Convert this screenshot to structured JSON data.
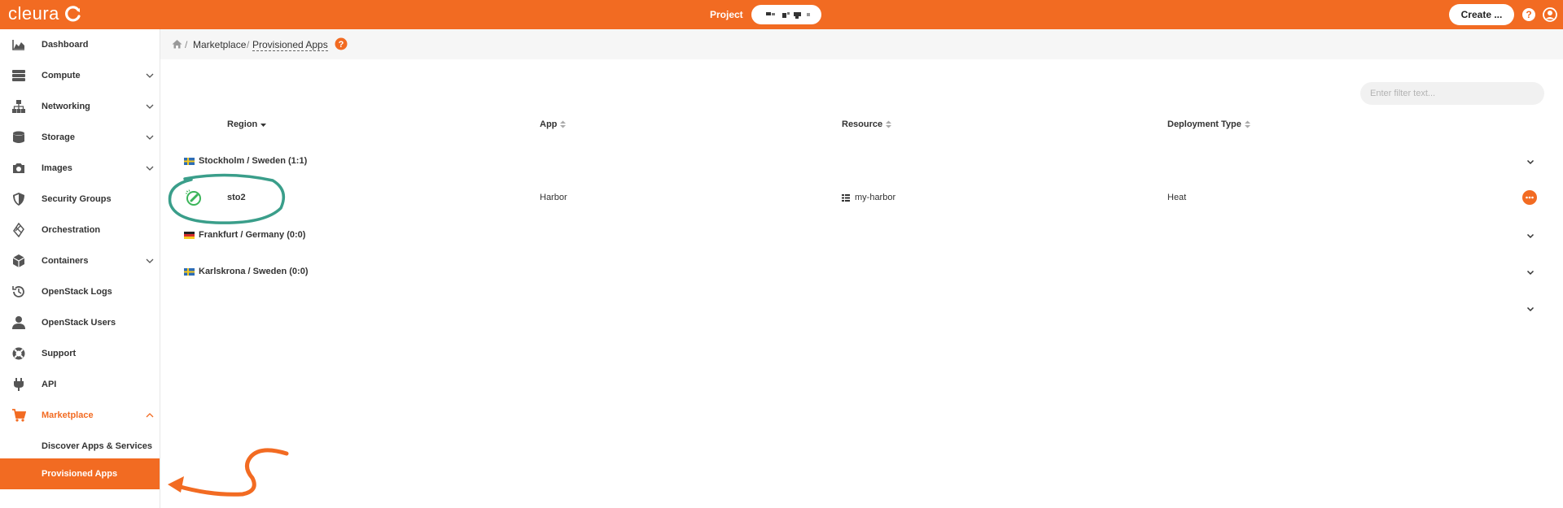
{
  "header": {
    "logo_text": "cleura",
    "project_label": "Project",
    "create_label": "Create ...",
    "brand_color": "#f26b22"
  },
  "sidebar": {
    "items": [
      {
        "label": "Dashboard",
        "icon": "chart-area-icon"
      },
      {
        "label": "Compute",
        "icon": "server-icon",
        "expandable": true
      },
      {
        "label": "Networking",
        "icon": "network-icon",
        "expandable": true
      },
      {
        "label": "Storage",
        "icon": "database-icon",
        "expandable": true
      },
      {
        "label": "Images",
        "icon": "camera-icon",
        "expandable": true
      },
      {
        "label": "Security Groups",
        "icon": "shield-icon"
      },
      {
        "label": "Orchestration",
        "icon": "orchestration-icon"
      },
      {
        "label": "Containers",
        "icon": "cube-icon",
        "expandable": true
      },
      {
        "label": "OpenStack Logs",
        "icon": "history-icon"
      },
      {
        "label": "OpenStack Users",
        "icon": "user-icon"
      },
      {
        "label": "Support",
        "icon": "lifebuoy-icon"
      },
      {
        "label": "API",
        "icon": "plug-icon"
      },
      {
        "label": "Marketplace",
        "icon": "cart-icon",
        "expanded": true
      },
      {
        "label": "Discover Apps & Services",
        "sub": true
      },
      {
        "label": "Provisioned Apps",
        "sub": true,
        "selected": true
      }
    ]
  },
  "breadcrumb": {
    "sep1": "/",
    "marketplace": "Marketplace",
    "sep2": "/",
    "current": "Provisioned Apps"
  },
  "filter": {
    "placeholder": "Enter filter text..."
  },
  "table": {
    "columns": [
      "Region",
      "App",
      "Resource",
      "Deployment Type"
    ],
    "groups": [
      {
        "label": "Stockholm / Sweden (1:1)",
        "flag": "sweden"
      },
      {
        "label": "Frankfurt / Germany (0:0)",
        "flag": "germany"
      },
      {
        "label": "Karlskrona / Sweden (0:0)",
        "flag": "sweden"
      }
    ],
    "row": {
      "region": "sto2",
      "app": "Harbor",
      "resource": "my-harbor",
      "deployment_type": "Heat"
    }
  },
  "colors": {
    "accent": "#f26b22",
    "annotation_teal": "#3a9e8a"
  }
}
